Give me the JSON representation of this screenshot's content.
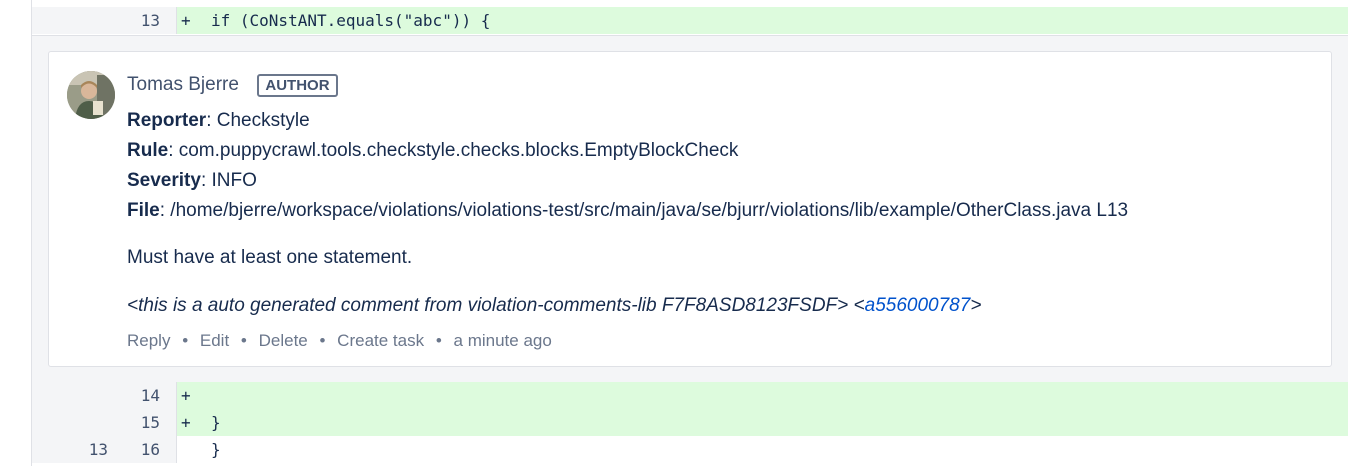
{
  "diff": {
    "top_line": {
      "new_num": "13",
      "marker": "+",
      "code": "if (CoNstANT.equals(\"abc\")) {"
    },
    "bottom_lines": [
      {
        "old_num": "",
        "new_num": "14",
        "marker": "+",
        "code": ""
      },
      {
        "old_num": "",
        "new_num": "15",
        "marker": "+",
        "code": "}"
      },
      {
        "old_num": "13",
        "new_num": "16",
        "marker": "",
        "code": "}"
      }
    ]
  },
  "comment": {
    "author": "Tomas Bjerre",
    "badge": "AUTHOR",
    "fields": [
      {
        "label": "Reporter",
        "value": ": Checkstyle"
      },
      {
        "label": "Rule",
        "value": ": com.puppycrawl.tools.checkstyle.checks.blocks.EmptyBlockCheck"
      },
      {
        "label": "Severity",
        "value": ": INFO"
      },
      {
        "label": "File",
        "value": ": /home/bjerre/workspace/violations/violations-test/src/main/java/se/bjurr/violations/lib/example/OtherClass.java L13"
      }
    ],
    "message": "Must have at least one statement.",
    "autogen": {
      "prefix": "<this is a auto generated comment from violation-comments-lib F7F8ASD8123FSDF> <",
      "link": "a556000787",
      "suffix": ">"
    },
    "actions": {
      "reply": "Reply",
      "edit": "Edit",
      "delete": "Delete",
      "create_task": "Create task",
      "timestamp": "a minute ago",
      "separator": "•"
    }
  },
  "icons": {
    "avatar": "user-avatar-photo"
  },
  "colors": {
    "added_line_bg": "#ddfbdd",
    "link": "#0052cc",
    "muted": "#6b778c"
  }
}
